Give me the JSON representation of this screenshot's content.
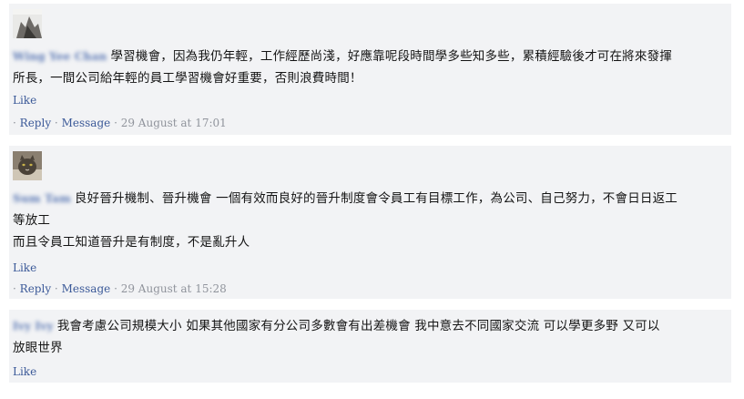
{
  "comments": [
    {
      "author": "Wing Yee Chan",
      "avatar_icon": "user-photo-icon",
      "text_before": "學習機會，因為我仍年輕，工作經歷尚淺，好應靠呢段時間學多些知多些，累積經驗後才可在將來發揮",
      "text_after": "所長，一間公司給年輕的員工學習機會好重要，否則浪費時間！",
      "like_label": "Like",
      "reply_label": "Reply",
      "message_label": "Message",
      "timestamp": "29 August at 17:01"
    },
    {
      "author": "Sum Tam",
      "avatar_icon": "cat-photo-icon",
      "text_before": "良好晉升機制、晉升機會 一個有效而良好的晉升制度會令員工有目標工作，為公司、自己努力，不會日日返工",
      "text_after": "等放工",
      "text_line3": "而且令員工知道晉升是有制度，不是亂升人",
      "like_label": "Like",
      "reply_label": "Reply",
      "message_label": "Message",
      "timestamp": "29 August at 15:28"
    },
    {
      "author": "Ivy Ivy",
      "text_before": "我會考慮公司規模大小 如果其他國家有分公司多數會有出差機會 我中意去不同國家交流 可以學更多野 又可以",
      "text_after": "放眼世界",
      "like_label": "Like"
    }
  ],
  "colors": {
    "link": "#3b5998",
    "name": "#5d7ab5",
    "meta": "#90949c",
    "card_bg": "#f2f3f5"
  }
}
